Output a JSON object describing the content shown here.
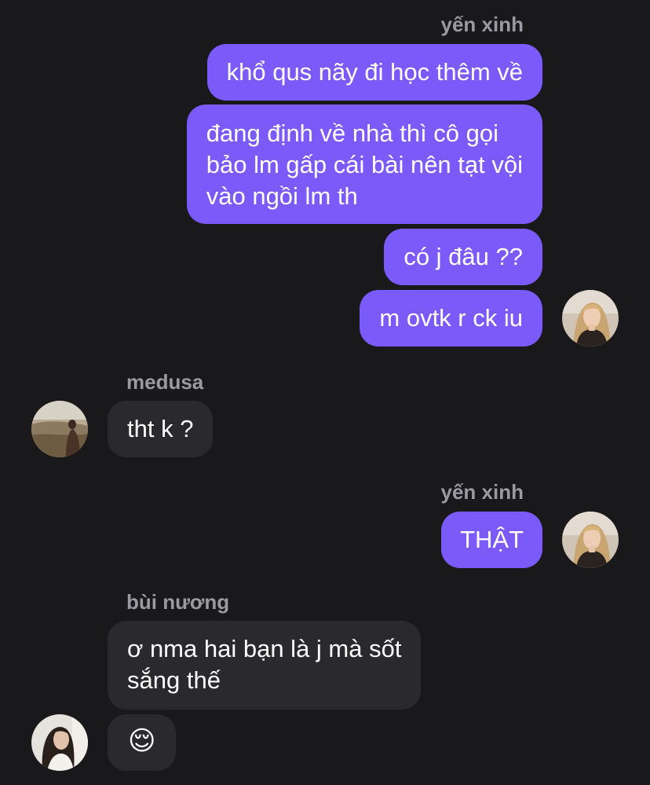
{
  "messages": {
    "group1_sender": "yến xinh",
    "m1": "khổ qus nãy đi học thêm về",
    "m2_line1": "đang định về nhà thì cô gọi",
    "m2_line2": "bảo lm gấp cái bài nên tạt vội",
    "m2_line3": "vào ngồi lm th",
    "m3": "có j đâu ??",
    "m4": "m ovtk r ck iu",
    "group2_sender": "medusa",
    "m5": "tht k ?",
    "group3_sender": "yến xinh",
    "m6": "THẬT",
    "group4_sender": "bùi nương",
    "m7_line1": "ơ nma hai bạn là j mà sốt",
    "m7_line2": "sắng thế",
    "m8": "😌"
  },
  "colors": {
    "background": "#19191b",
    "outgoing_bubble": "#7a5af8",
    "incoming_bubble": "#2a2a2e",
    "sender_name": "#9a9aa0"
  },
  "icons": {
    "avatar_yen": "avatar-photo-blonde-woman",
    "avatar_medusa": "avatar-photo-person-outdoors",
    "avatar_nuong": "avatar-photo-dark-hair-woman"
  }
}
